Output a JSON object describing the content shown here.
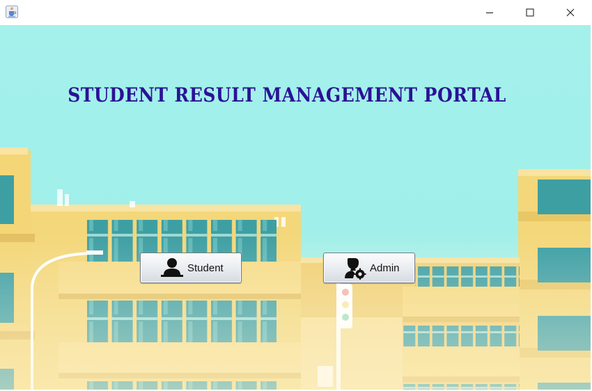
{
  "window": {
    "icon": "java-cup-icon",
    "controls": {
      "minimize": "minimize-icon",
      "maximize": "maximize-icon",
      "close": "close-icon"
    }
  },
  "main": {
    "title": "STUDENT RESULT MANAGEMENT PORTAL",
    "title_color": "#2a1296",
    "buttons": [
      {
        "label": "Student",
        "icon": "user-icon"
      },
      {
        "label": "Admin",
        "icon": "admin-gear-icon"
      }
    ]
  },
  "colors": {
    "sky": "#a4f1ec",
    "building": "#f3d77a",
    "window_glass": "#3d9ea2"
  }
}
